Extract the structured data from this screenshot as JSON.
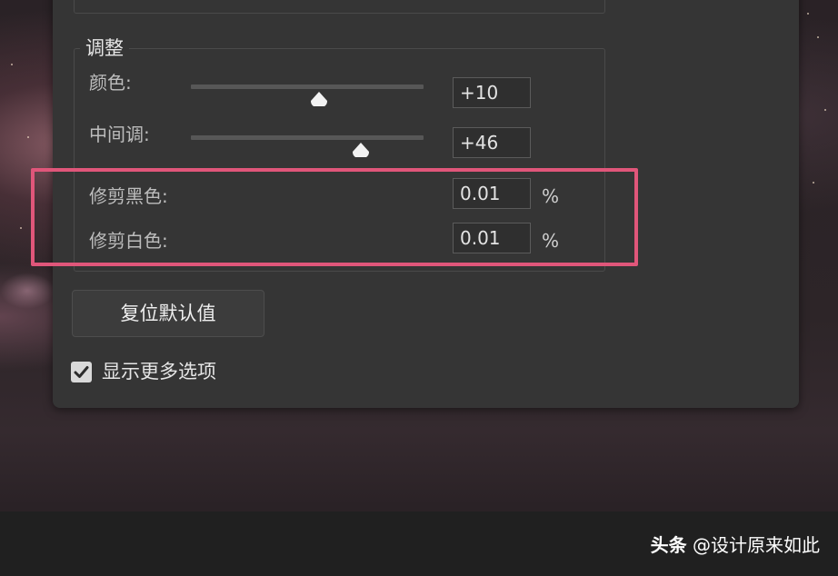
{
  "dialog": {
    "group_title": "调整",
    "rows": {
      "color": {
        "label": "颜色:",
        "value": "+10",
        "slider_fraction": 0.55
      },
      "midtone": {
        "label": "中间调:",
        "value": "+46",
        "slider_fraction": 0.73
      },
      "clip_black": {
        "label": "修剪黑色:",
        "value": "0.01",
        "unit": "%"
      },
      "clip_white": {
        "label": "修剪白色:",
        "value": "0.01",
        "unit": "%"
      }
    },
    "reset_button_label": "复位默认值",
    "show_more_options": {
      "label": "显示更多选项",
      "checked": true
    }
  },
  "watermark": {
    "brand": "头条",
    "handle": "@设计原来如此"
  },
  "colors": {
    "highlight": "#e0567a",
    "panel": "#353535"
  },
  "icons": {
    "checkbox": "check-icon",
    "slider_thumb": "slider-thumb-icon"
  }
}
